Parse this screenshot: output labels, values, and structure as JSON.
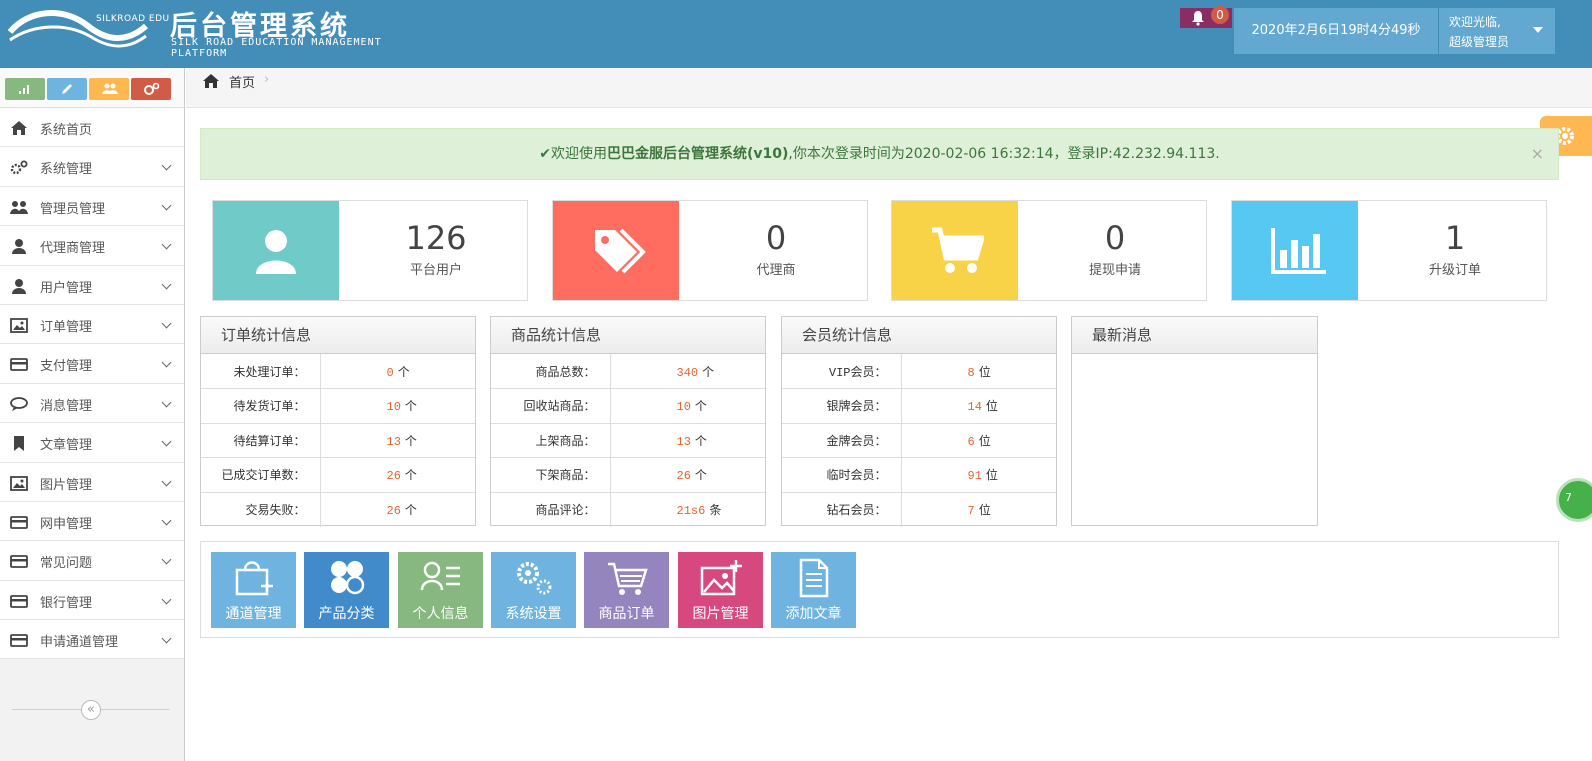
{
  "header": {
    "brand_small": "SILKROAD EDU",
    "title_cn": "后台管理系统",
    "title_en": "SILK ROAD EDUCATION MANAGEMENT PLATFORM",
    "notification_count": "0",
    "datetime": "2020年2月6日19时4分49秒",
    "welcome": "欢迎光临,",
    "role": "超级管理员"
  },
  "sidebar": {
    "shortcut_colors": [
      "#87b87f",
      "#6fb3e0",
      "#ffb752",
      "#d15b47"
    ],
    "items": [
      {
        "label": "系统首页",
        "icon": "home-icon",
        "chevron": false
      },
      {
        "label": "系统管理",
        "icon": "cogs-icon",
        "chevron": true
      },
      {
        "label": "管理员管理",
        "icon": "group-icon",
        "chevron": true
      },
      {
        "label": "代理商管理",
        "icon": "user-icon",
        "chevron": true
      },
      {
        "label": "用户管理",
        "icon": "user-icon",
        "chevron": true
      },
      {
        "label": "订单管理",
        "icon": "picture-icon",
        "chevron": true
      },
      {
        "label": "支付管理",
        "icon": "credit-card-icon",
        "chevron": true
      },
      {
        "label": "消息管理",
        "icon": "comments-icon",
        "chevron": true
      },
      {
        "label": "文章管理",
        "icon": "bookmark-icon",
        "chevron": true
      },
      {
        "label": "图片管理",
        "icon": "picture-icon",
        "chevron": true
      },
      {
        "label": "网申管理",
        "icon": "credit-card-icon",
        "chevron": true
      },
      {
        "label": "常见问题",
        "icon": "credit-card-icon",
        "chevron": true
      },
      {
        "label": "银行管理",
        "icon": "credit-card-icon",
        "chevron": true
      },
      {
        "label": "申请通道管理",
        "icon": "credit-card-icon",
        "chevron": true
      }
    ],
    "collapse_glyph": "«"
  },
  "breadcrumb": {
    "home": "首页",
    "separator": "›"
  },
  "alert": {
    "check": "✔",
    "prefix": "欢迎使用",
    "system_name": "巴巴金服后台管理系统(v10)",
    "suffix": ",你本次登录时间为2020-02-06 16:32:14，登录IP:42.232.94.113.",
    "close": "×"
  },
  "stats": [
    {
      "value": "126",
      "label": "平台用户",
      "color": "#6fcac8",
      "icon": "user-icon"
    },
    {
      "value": "0",
      "label": "代理商",
      "color": "#ff6c60",
      "icon": "tags-icon"
    },
    {
      "value": "0",
      "label": "提现申请",
      "color": "#f8d347",
      "icon": "cart-icon"
    },
    {
      "value": "1",
      "label": "升级订单",
      "color": "#57c8f2",
      "icon": "bar-chart-icon"
    }
  ],
  "panels": {
    "orders": {
      "title": "订单统计信息",
      "rows": [
        {
          "k": "未处理订单：",
          "v": "0",
          "u": "个"
        },
        {
          "k": "待发货订单：",
          "v": "10",
          "u": "个"
        },
        {
          "k": "待结算订单：",
          "v": "13",
          "u": "个"
        },
        {
          "k": "已成交订单数：",
          "v": "26",
          "u": "个"
        },
        {
          "k": "交易失败：",
          "v": "26",
          "u": "个"
        }
      ]
    },
    "products": {
      "title": "商品统计信息",
      "rows": [
        {
          "k": "商品总数：",
          "v": "340",
          "u": "个"
        },
        {
          "k": "回收站商品：",
          "v": "10",
          "u": "个"
        },
        {
          "k": "上架商品：",
          "v": "13",
          "u": "个"
        },
        {
          "k": "下架商品：",
          "v": "26",
          "u": "个"
        },
        {
          "k": "商品评论：",
          "v": "21s6",
          "u": "条"
        }
      ]
    },
    "members": {
      "title": "会员统计信息",
      "rows": [
        {
          "k": "VIP会员：",
          "v": "8",
          "u": "位"
        },
        {
          "k": "银牌会员：",
          "v": "14",
          "u": "位"
        },
        {
          "k": "金牌会员：",
          "v": "6",
          "u": "位"
        },
        {
          "k": "临时会员：",
          "v": "91",
          "u": "位"
        },
        {
          "k": "钻石会员：",
          "v": "7",
          "u": "位"
        }
      ]
    },
    "news": {
      "title": "最新消息"
    }
  },
  "tiles": [
    {
      "label": "通道管理",
      "color": "#6fb3e0",
      "icon": "shopping-bag-icon"
    },
    {
      "label": "产品分类",
      "color": "#428bca",
      "icon": "category-icon"
    },
    {
      "label": "个人信息",
      "color": "#87b87f",
      "icon": "profile-icon"
    },
    {
      "label": "系统设置",
      "color": "#6fb3e0",
      "icon": "settings-icon"
    },
    {
      "label": "商品订单",
      "color": "#9585bf",
      "icon": "cart-icon"
    },
    {
      "label": "图片管理",
      "color": "#d6487e",
      "icon": "add-image-icon"
    },
    {
      "label": "添加文章",
      "color": "#6fb3e0",
      "icon": "document-icon"
    }
  ],
  "floating_badge": "7"
}
